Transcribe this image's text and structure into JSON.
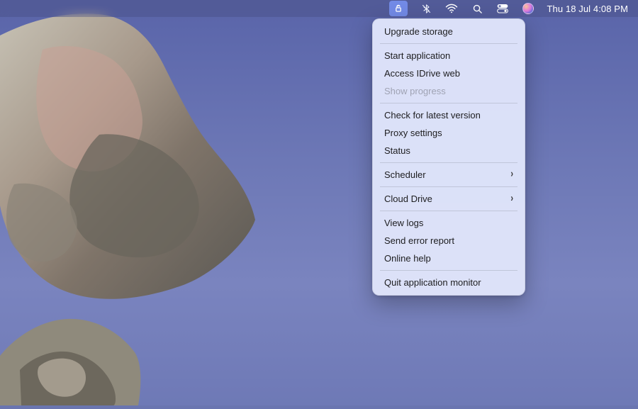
{
  "menubar": {
    "clock_text": "Thu 18 Jul  4:08 PM",
    "icons": {
      "app": "idrive-icon",
      "bluetooth": "bluetooth-off-icon",
      "wifi": "wifi-icon",
      "search": "search-icon",
      "control_center": "control-center-icon",
      "siri": "siri-icon"
    }
  },
  "dropdown": {
    "groups": [
      [
        {
          "label": "Upgrade storage",
          "submenu": false,
          "disabled": false
        }
      ],
      [
        {
          "label": "Start application",
          "submenu": false,
          "disabled": false
        },
        {
          "label": "Access IDrive web",
          "submenu": false,
          "disabled": false
        },
        {
          "label": "Show progress",
          "submenu": false,
          "disabled": true
        }
      ],
      [
        {
          "label": "Check for latest version",
          "submenu": false,
          "disabled": false
        },
        {
          "label": "Proxy settings",
          "submenu": false,
          "disabled": false
        },
        {
          "label": "Status",
          "submenu": false,
          "disabled": false
        }
      ],
      [
        {
          "label": "Scheduler",
          "submenu": true,
          "disabled": false
        }
      ],
      [
        {
          "label": "Cloud Drive",
          "submenu": true,
          "disabled": false
        }
      ],
      [
        {
          "label": "View logs",
          "submenu": false,
          "disabled": false
        },
        {
          "label": "Send error report",
          "submenu": false,
          "disabled": false
        },
        {
          "label": "Online help",
          "submenu": false,
          "disabled": false
        }
      ],
      [
        {
          "label": "Quit application monitor",
          "submenu": false,
          "disabled": false
        }
      ]
    ]
  }
}
